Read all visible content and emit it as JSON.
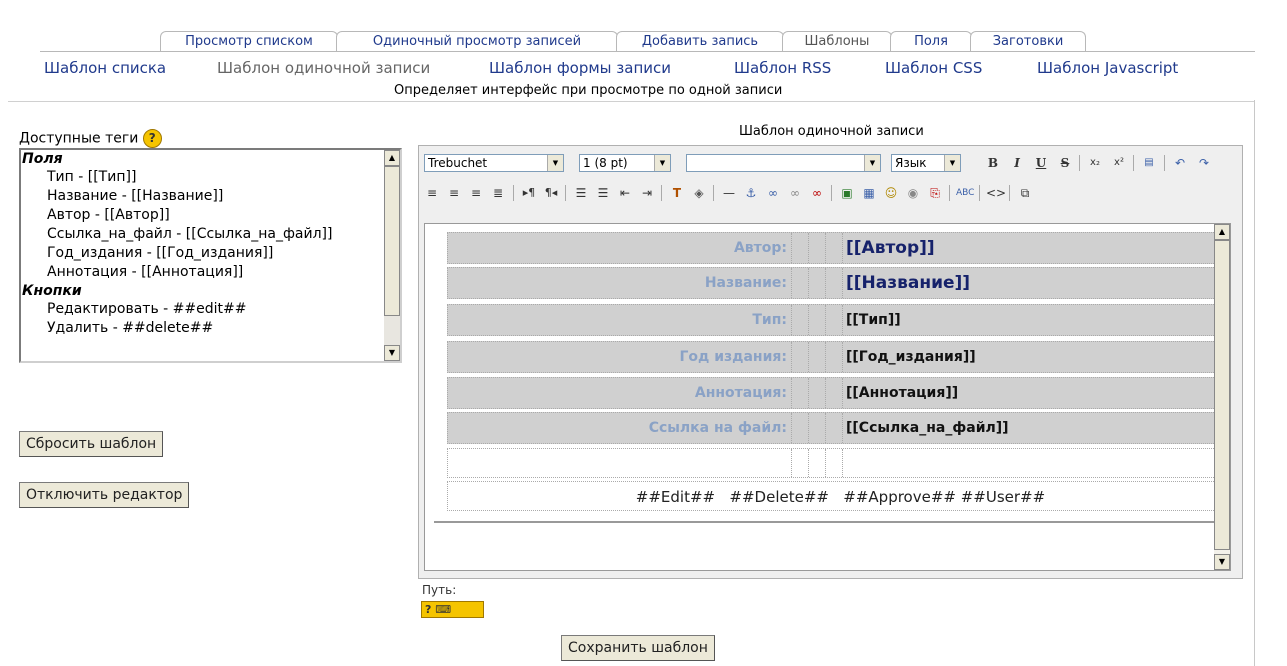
{
  "tabs": [
    {
      "label": "Просмотр списком",
      "active": false
    },
    {
      "label": "Одиночный просмотр записей",
      "active": false
    },
    {
      "label": "Добавить запись",
      "active": false
    },
    {
      "label": "Шаблоны",
      "active": true
    },
    {
      "label": "Поля",
      "active": false
    },
    {
      "label": "Заготовки",
      "active": false
    }
  ],
  "subtabs": [
    {
      "label": "Шаблон списка",
      "active": false
    },
    {
      "label": "Шаблон одиночной записи",
      "active": true
    },
    {
      "label": "Шаблон формы записи",
      "active": false
    },
    {
      "label": "Шаблон RSS",
      "active": false
    },
    {
      "label": "Шаблон CSS",
      "active": false
    },
    {
      "label": "Шаблон Javascript",
      "active": false
    }
  ],
  "description": "Определяет интерфейс при просмотре по одной записи",
  "available_tags": {
    "label": "Доступные теги",
    "help_icon": "help-icon",
    "group_fields": "Поля",
    "fields": [
      "Тип - [[Тип]]",
      "Название - [[Название]]",
      "Автор - [[Автор]]",
      "Ссылка_на_файл - [[Ссылка_на_файл]]",
      "Год_издания - [[Год_издания]]",
      "Аннотация - [[Аннотация]]"
    ],
    "group_buttons": "Кнопки",
    "buttons": [
      "Редактировать - ##edit##",
      "Удалить - ##delete##"
    ]
  },
  "reset_button": "Сбросить шаблон",
  "disable_editor_button": "Отключить редактор",
  "editor": {
    "title": "Шаблон одиночной записи",
    "font": "Trebuchet",
    "size": "1 (8 pt)",
    "format": "",
    "language": "Язык",
    "path_label": "Путь:",
    "rows": [
      {
        "label": "Автор:",
        "value": "[[Автор]]"
      },
      {
        "label": "Название:",
        "value": "[[Название]]"
      },
      {
        "label": "Тип:",
        "value": "[[Тип]]"
      },
      {
        "label": "Год издания:",
        "value": "[[Год_издания]]"
      },
      {
        "label": "Аннотация:",
        "value": "[[Аннотация]]"
      },
      {
        "label": "Ссылка на файл:",
        "value": "[[Ссылка_на_файл]]"
      }
    ],
    "actions": "##Edit##   ##Delete##   ##Approve## ##User##"
  },
  "save_button": "Сохранить шаблон",
  "colors": {
    "link": "#203a8c",
    "label": "#8aa2c6",
    "row_bg": "#d0d0d0"
  }
}
